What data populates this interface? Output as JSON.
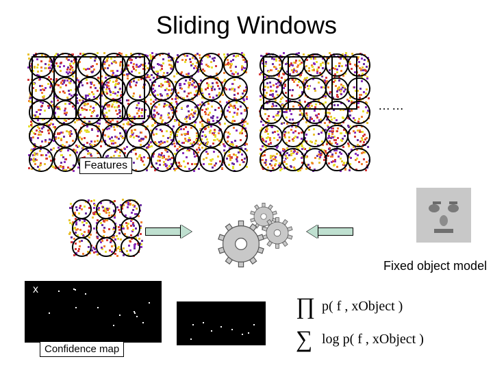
{
  "title": "Sliding Windows",
  "labels": {
    "features": "Features",
    "fixed_model": "Fixed object model",
    "conf_map": "Confidence map",
    "x": "x",
    "dots": "……"
  },
  "math": {
    "line1_sym": "∏",
    "line2_sym": "∑",
    "expr": "p( f , xObject )",
    "log_prefix": "log "
  }
}
